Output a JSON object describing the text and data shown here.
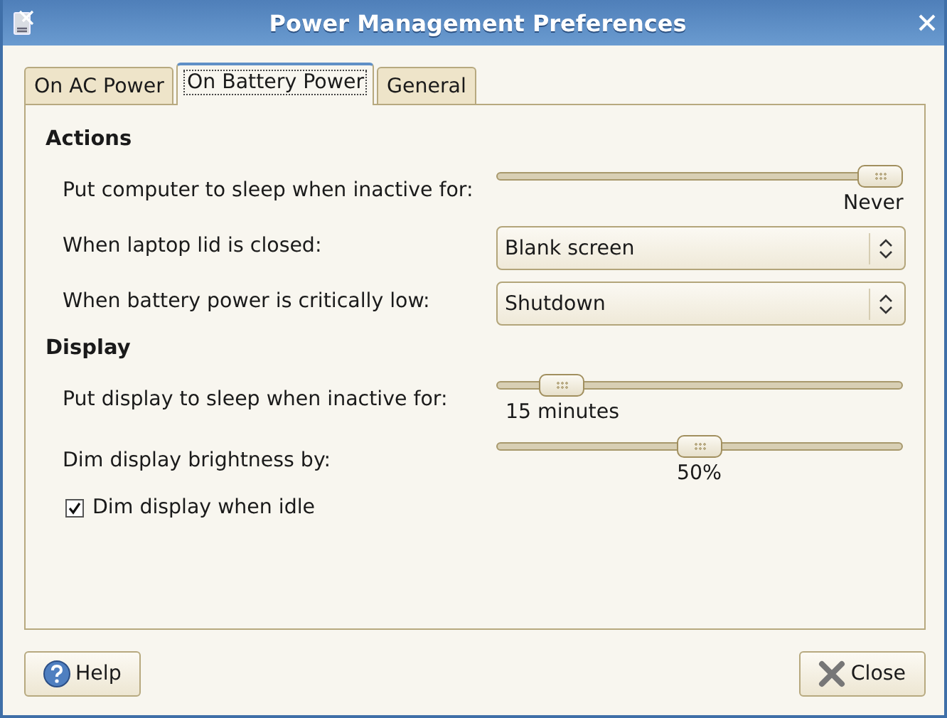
{
  "window": {
    "title": "Power Management Preferences"
  },
  "tabs": [
    {
      "label": "On AC Power",
      "selected": false
    },
    {
      "label": "On Battery Power",
      "selected": true
    },
    {
      "label": "General",
      "selected": false
    }
  ],
  "sections": [
    {
      "title": "Actions",
      "rows": [
        {
          "kind": "slider",
          "label": "Put computer to sleep when inactive for:",
          "level": 1,
          "reading": "Never"
        },
        {
          "kind": "combo",
          "label": "When laptop lid is closed:",
          "value": "Blank screen"
        },
        {
          "kind": "combo",
          "label": "When battery power is critically low:",
          "value": "Shutdown"
        }
      ]
    },
    {
      "title": "Display",
      "rows": [
        {
          "kind": "slider",
          "label": "Put display to sleep when inactive for:",
          "level": 0.12,
          "reading": "15 minutes"
        },
        {
          "kind": "slider",
          "label": "Dim display brightness by:",
          "level": 0.5,
          "reading": "50%"
        },
        {
          "kind": "check",
          "label": "Dim display when idle",
          "checked": true
        }
      ]
    }
  ],
  "buttons": [
    {
      "kind": "help",
      "label": "Help"
    },
    {
      "kind": "close",
      "label": "Close"
    }
  ]
}
